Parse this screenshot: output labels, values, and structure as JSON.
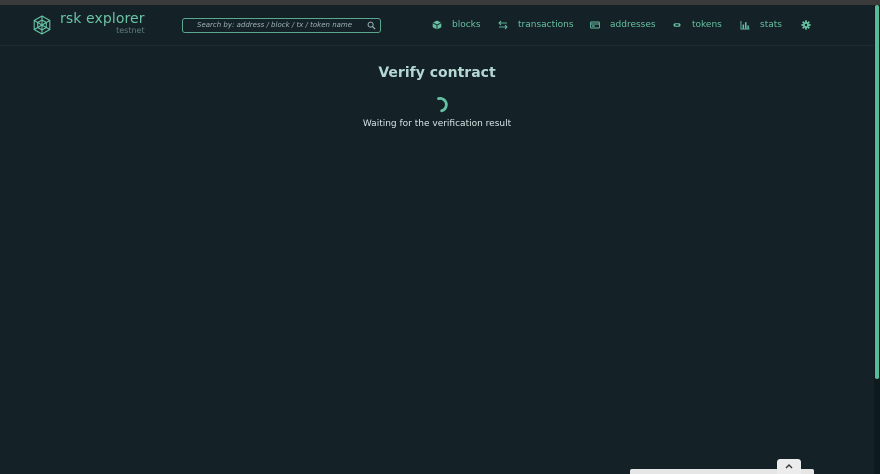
{
  "brand": {
    "name": "rsk explorer",
    "network": "testnet",
    "logo_icon": "rsk-logo-icon"
  },
  "search": {
    "placeholder": "Search by: address / block / tx / token name",
    "value": "",
    "icon": "search-icon"
  },
  "nav": {
    "items": [
      {
        "label": "blocks",
        "icon": "cube-icon"
      },
      {
        "label": "transactions",
        "icon": "arrows-exchange-icon"
      },
      {
        "label": "addresses",
        "icon": "card-icon"
      },
      {
        "label": "tokens",
        "icon": "token-icon"
      },
      {
        "label": "stats",
        "icon": "bar-chart-icon"
      }
    ],
    "settings_icon": "gear-icon"
  },
  "main": {
    "title": "Verify contract",
    "status": "Waiting for the verification result"
  },
  "colors": {
    "background": "#142127",
    "accent": "#66c1a3",
    "title": "#b5d8d3",
    "text": "#d7e6e5"
  }
}
